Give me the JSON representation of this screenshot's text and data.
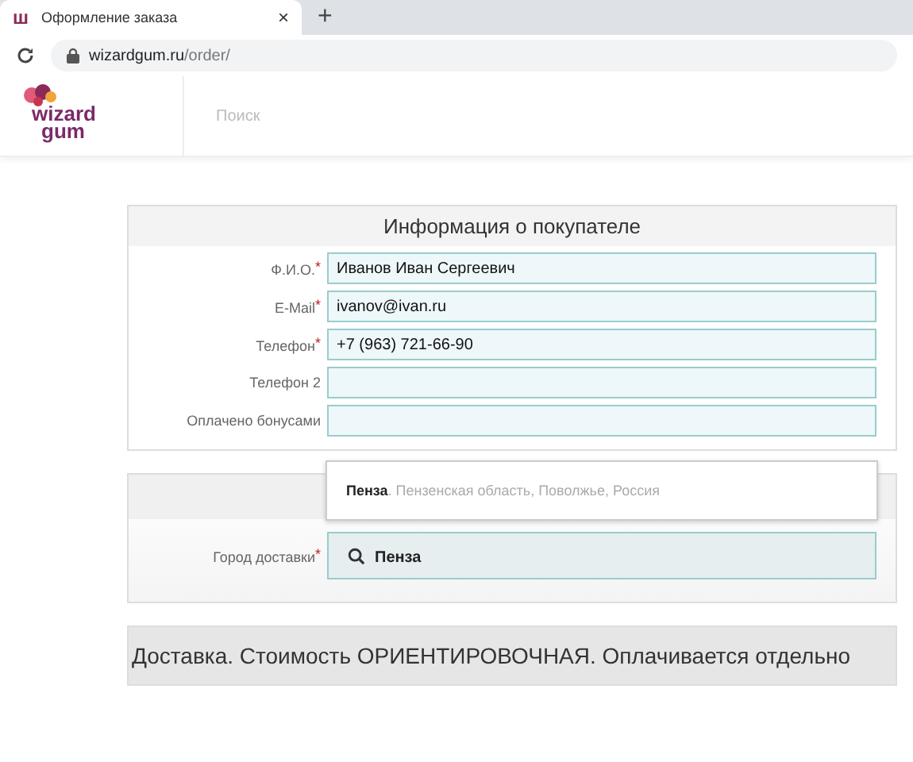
{
  "browser": {
    "tab": {
      "title": "Оформление заказа",
      "favicon": "ш",
      "close": "×",
      "selected": true
    },
    "new_tab": "+",
    "url_host": "wizardgum.ru",
    "url_path": "/order/"
  },
  "header": {
    "logo_line1": "wizard",
    "logo_line2": "gum",
    "search": {
      "placeholder": "Поиск"
    }
  },
  "buyer_info": {
    "title": "Информация о покупателе",
    "fields": [
      {
        "label": "Ф.И.О.$^{*}$",
        "value": "Иванов Иван Сергеевич"
      },
      {
        "label": "E-Mail$^{*}$",
        "value": "ivanov@ivan.ru"
      },
      {
        "label": "Телефон$^{*}$",
        "value": "+7 (963) 721-66-90"
      },
      {
        "label": "Телефон 2"
      },
      {
        "label": "Оплачено бонусами"
      }
    ]
  },
  "delivery_city": {
    "label": "Город доставки$^{*}$",
    "value": "Пенза",
    "suggestions": [
      "**Пенза**. Пензенская область, Поволжье, Россия"
    ]
  },
  "delivery": {
    "title": "Доставка. Стоимость ОРИЕНТИРОВОЧНАЯ. Оплачивается отдельно"
  }
}
